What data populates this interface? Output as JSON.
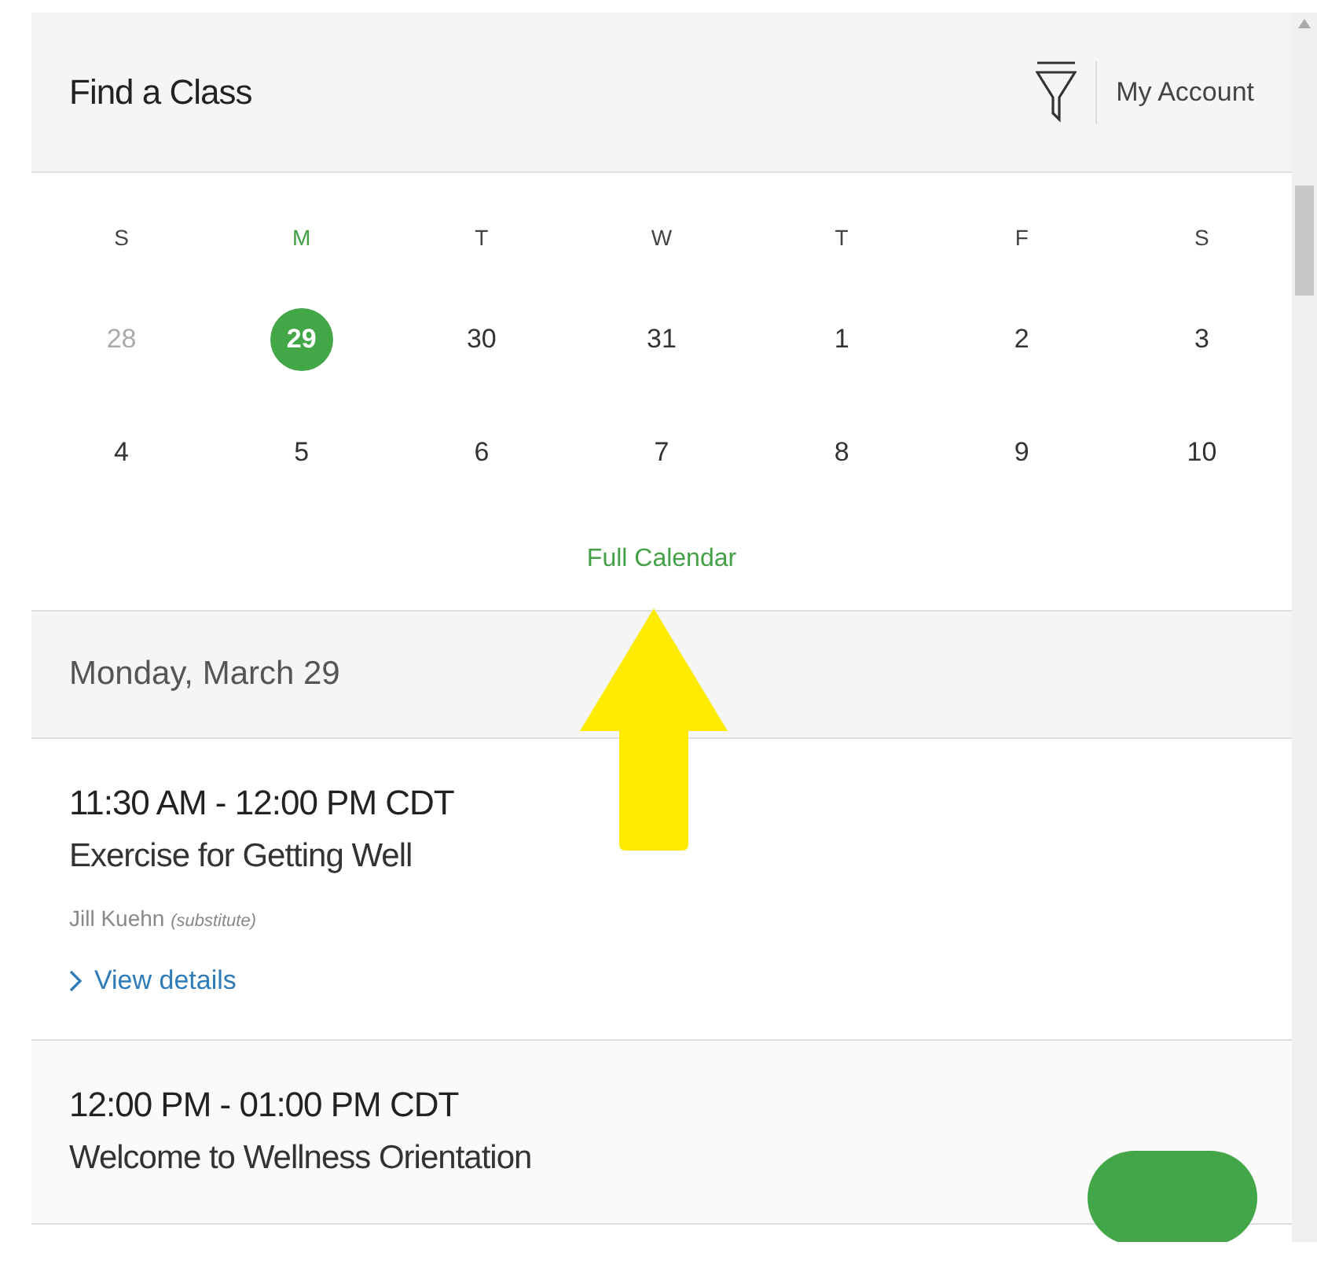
{
  "header": {
    "title": "Find a Class",
    "account": "My Account"
  },
  "weekdays": [
    {
      "label": "S",
      "selected": false
    },
    {
      "label": "M",
      "selected": true
    },
    {
      "label": "T",
      "selected": false
    },
    {
      "label": "W",
      "selected": false
    },
    {
      "label": "T",
      "selected": false
    },
    {
      "label": "F",
      "selected": false
    },
    {
      "label": "S",
      "selected": false
    }
  ],
  "days": [
    {
      "label": "28",
      "selected": false,
      "muted": true
    },
    {
      "label": "29",
      "selected": true,
      "muted": false
    },
    {
      "label": "30",
      "selected": false,
      "muted": false
    },
    {
      "label": "31",
      "selected": false,
      "muted": false
    },
    {
      "label": "1",
      "selected": false,
      "muted": false
    },
    {
      "label": "2",
      "selected": false,
      "muted": false
    },
    {
      "label": "3",
      "selected": false,
      "muted": false
    },
    {
      "label": "4",
      "selected": false,
      "muted": false
    },
    {
      "label": "5",
      "selected": false,
      "muted": false
    },
    {
      "label": "6",
      "selected": false,
      "muted": false
    },
    {
      "label": "7",
      "selected": false,
      "muted": false
    },
    {
      "label": "8",
      "selected": false,
      "muted": false
    },
    {
      "label": "9",
      "selected": false,
      "muted": false
    },
    {
      "label": "10",
      "selected": false,
      "muted": false
    }
  ],
  "full_calendar": "Full Calendar",
  "date_heading": "Monday, March 29",
  "classes": [
    {
      "time": "11:30 AM - 12:00 PM CDT",
      "name": "Exercise for Getting Well",
      "instructor": "Jill Kuehn",
      "note": "(substitute)",
      "details": "View details"
    },
    {
      "time": "12:00 PM - 01:00 PM CDT",
      "name": "Welcome to Wellness Orientation"
    }
  ]
}
